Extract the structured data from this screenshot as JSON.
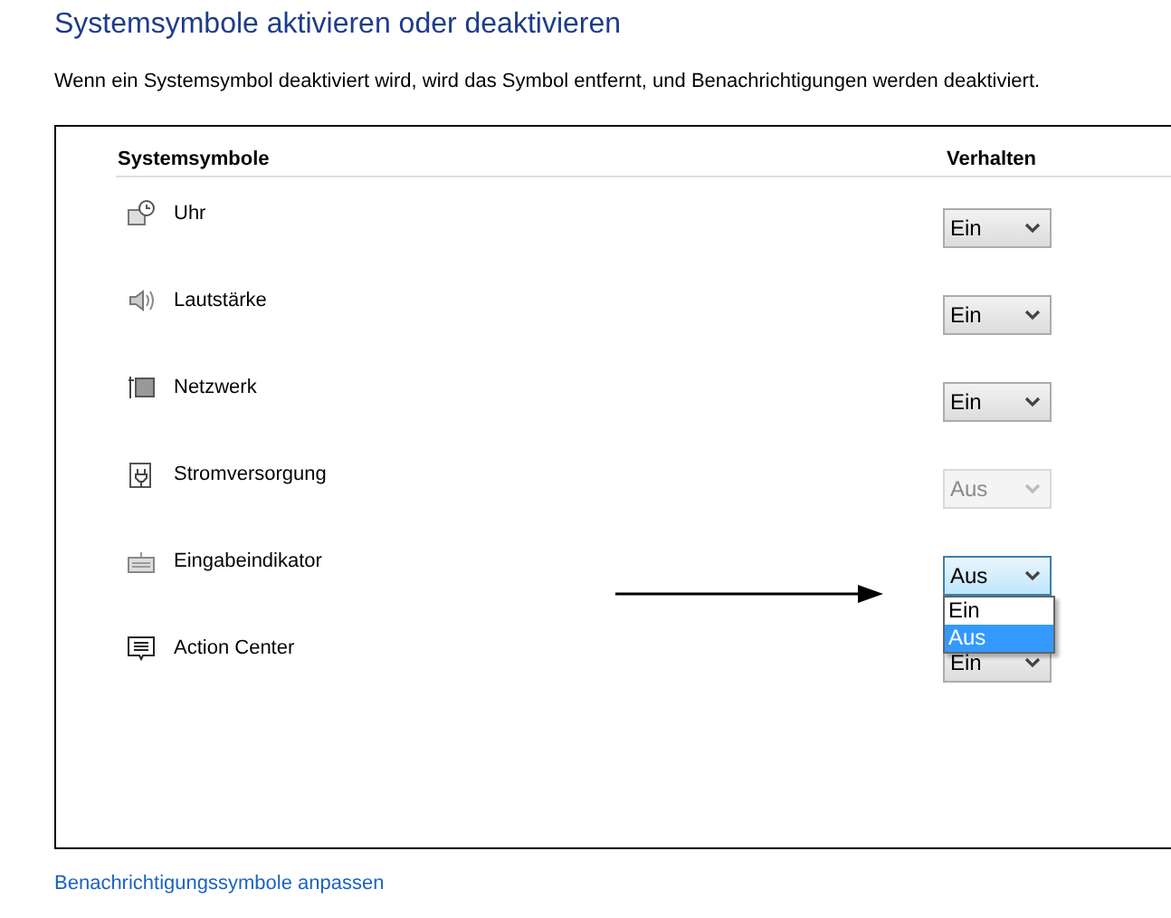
{
  "title": "Systemsymbole aktivieren oder deaktivieren",
  "description": "Wenn ein Systemsymbol deaktiviert wird, wird das Symbol entfernt, und Benachrichtigungen werden deaktiviert.",
  "table": {
    "columns": [
      "Systemsymbole",
      "Verhalten"
    ],
    "rows": [
      {
        "label": "Uhr",
        "value": "Ein",
        "disabled": false,
        "open": false
      },
      {
        "label": "Lautstärke",
        "value": "Ein",
        "disabled": false,
        "open": false
      },
      {
        "label": "Netzwerk",
        "value": "Ein",
        "disabled": false,
        "open": false
      },
      {
        "label": "Stromversorgung",
        "value": "Aus",
        "disabled": true,
        "open": false
      },
      {
        "label": "Eingabeindikator",
        "value": "Aus",
        "disabled": false,
        "open": true,
        "options": [
          {
            "label": "Ein",
            "selected": false
          },
          {
            "label": "Aus",
            "selected": true
          }
        ]
      },
      {
        "label": "Action Center",
        "value": "Ein",
        "disabled": false,
        "open": false
      }
    ]
  },
  "link": "Benachrichtigungssymbole anpassen"
}
